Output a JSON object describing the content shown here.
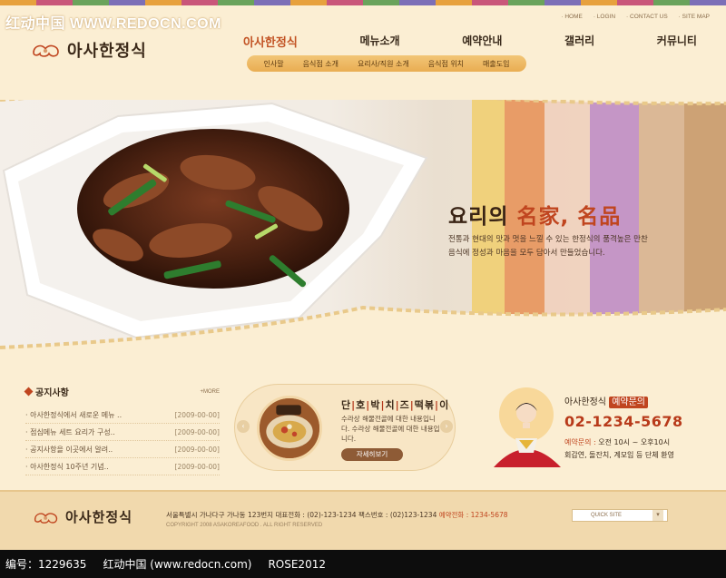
{
  "watermark": "红动中国 WWW.REDOCN.COM",
  "brand": {
    "name": "아사한정식"
  },
  "utility_links": [
    "HOME",
    "LOGIN",
    "CONTACT US",
    "SITE MAP"
  ],
  "gnb": [
    {
      "label": "아사한정식"
    },
    {
      "label": "메뉴소개"
    },
    {
      "label": "예약안내"
    },
    {
      "label": "갤러리"
    },
    {
      "label": "커뮤니티"
    }
  ],
  "subnav": [
    "인사말",
    "음식점 소개",
    "요리사/직원 소개",
    "음식점 위치",
    "매출도입"
  ],
  "hero": {
    "title_pre": "요리의 ",
    "title_accent": "名家, 名品",
    "description_line1": "전통과 현대의 맛과 멋을 느낄 수 있는 한정식의 품격높은 만찬",
    "description_line2": "음식에 정성과 마음을 모두 담아서 만들었습니다."
  },
  "notice": {
    "title": "공지사항",
    "more": "+MORE",
    "items": [
      {
        "text": "· 아사한정식에서 새로운 메뉴 ..",
        "date": "[2009-00-00]"
      },
      {
        "text": "· 점심메뉴 세트 요리가 구성..",
        "date": "[2009-00-00]"
      },
      {
        "text": "· 공지사항을 이곳에서 알려..",
        "date": "[2009-00-00]"
      },
      {
        "text": "· 아사한정식 10주년 기념..",
        "date": "[2009-00-00]"
      }
    ]
  },
  "promo": {
    "title_parts": [
      "단",
      "호",
      "박",
      "치",
      "즈",
      "떡",
      "볶",
      "이"
    ],
    "description": "수라상 해물전골에 대한 내용입니다. 수라상 해물전골에 대한 내용입니다.",
    "button": "자세히보기",
    "prev_arrow": "‹",
    "next_arrow": "›"
  },
  "reservation": {
    "label_pre": "아사한정식 ",
    "label_tag": "예약문의",
    "phone": "02-1234-5678",
    "hours_key": "예약문의 : ",
    "hours_value": "오전 10시 ~ 오후10시",
    "groups": "회갑연, 돌잔치, 계모임 등 단체 환영"
  },
  "footer": {
    "address_pre": "서울특별시 가나다구 가나동 123번지  대표전화 : (02)-123-1234  팩스번호 : (02)123-1234  ",
    "reservation_key": "예약전화 : ",
    "reservation_phone": "1234-5678",
    "copyright": "COPYRIGHT 2008 ASAKOREAFOOD . ALL RIGHT RESERVED",
    "quick_site": "QUICK SITE",
    "quick_caret": "▾"
  },
  "bottom_bar": {
    "id_label": "编号：1229635",
    "site": "红动中国 (www.redocn.com)",
    "author": "ROSE2012"
  },
  "colors": {
    "background": "#fbeed3",
    "accent_red": "#c0451f",
    "brown": "#8e5b36",
    "subnav_orange": "#e9ad52"
  }
}
